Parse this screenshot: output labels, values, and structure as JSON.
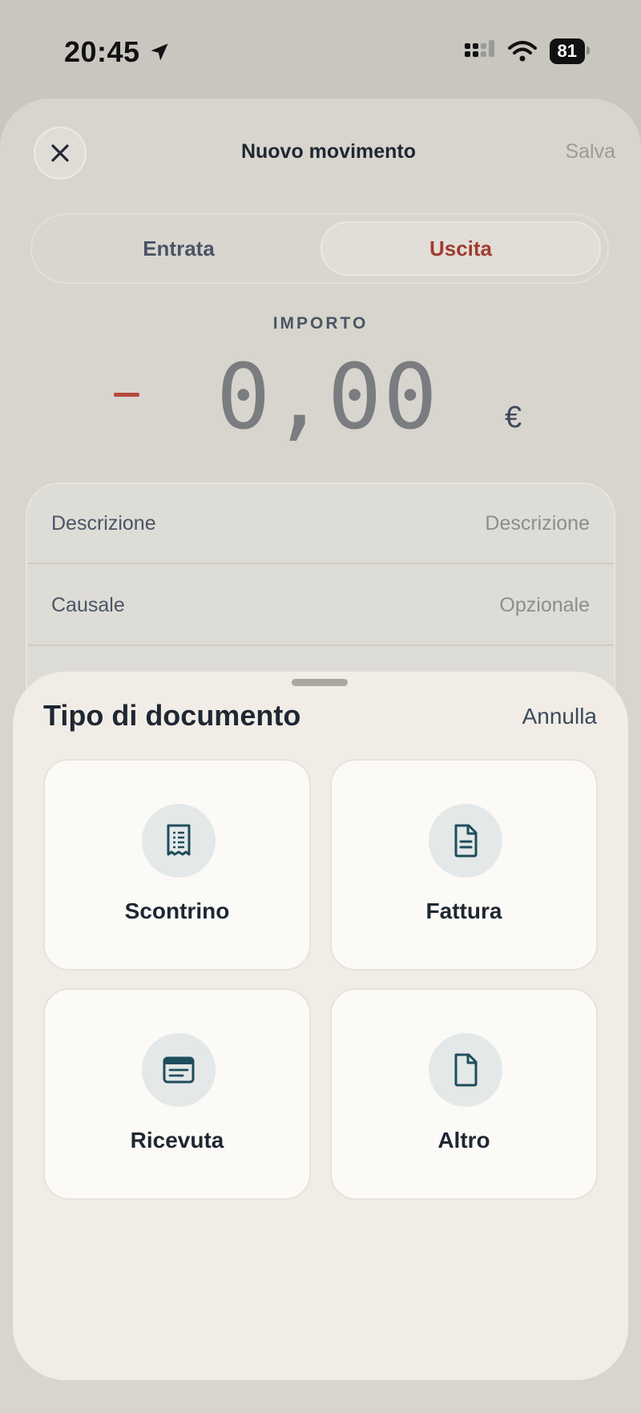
{
  "status_bar": {
    "time": "20:45",
    "battery": "81"
  },
  "nav": {
    "title": "Nuovo movimento",
    "save_label": "Salva"
  },
  "segmented": {
    "entrata": "Entrata",
    "uscita": "Uscita",
    "selected": "Uscita"
  },
  "amount": {
    "label": "IMPORTO",
    "sign": "−",
    "value": "0,00",
    "currency": "€"
  },
  "form": {
    "rows": [
      {
        "label": "Descrizione",
        "placeholder": "Descrizione"
      },
      {
        "label": "Causale",
        "placeholder": "Opzionale"
      }
    ]
  },
  "sheet": {
    "title": "Tipo di documento",
    "cancel_label": "Annulla",
    "options": [
      {
        "label": "Scontrino",
        "icon": "receipt-icon"
      },
      {
        "label": "Fattura",
        "icon": "invoice-icon"
      },
      {
        "label": "Ricevuta",
        "icon": "ricevuta-icon"
      },
      {
        "label": "Altro",
        "icon": "document-icon"
      }
    ]
  },
  "colors": {
    "accent_red": "#a13a31",
    "icon_teal": "#1e4d5c",
    "sheet_bg": "#f1ede6",
    "card_bg": "#fbfaf6"
  }
}
